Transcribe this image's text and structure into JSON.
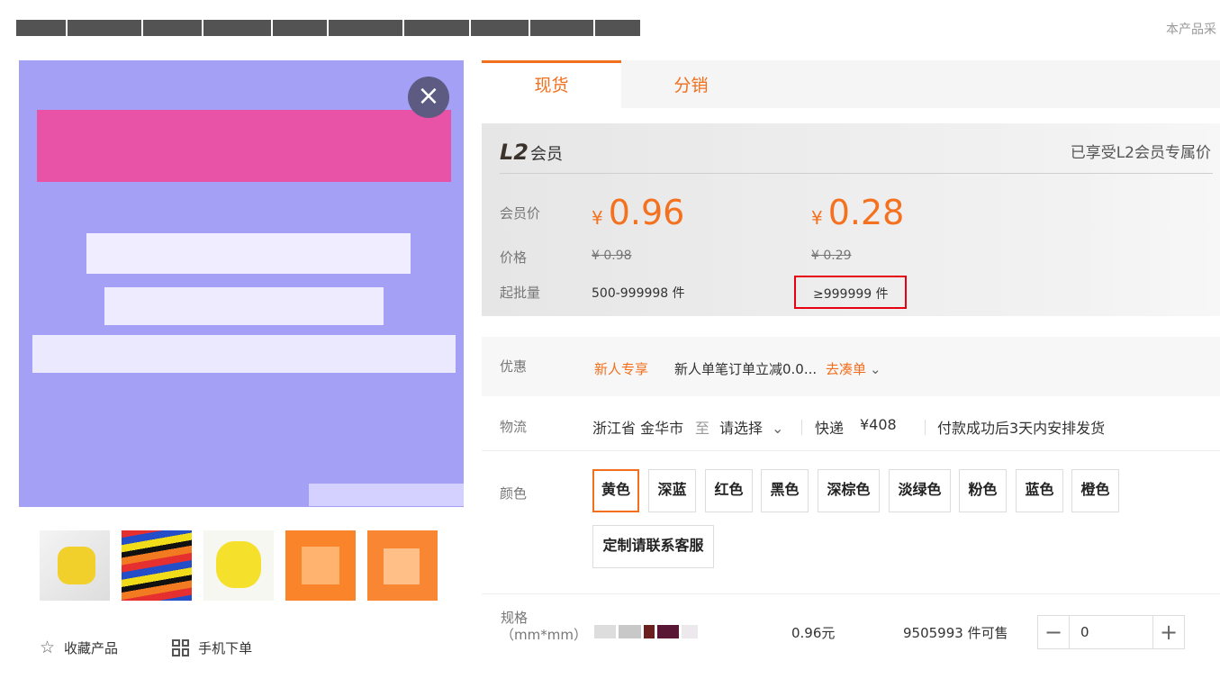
{
  "colors": {
    "accent": "#f16f1d",
    "highlight_border": "#e60012",
    "image_background": "#a4a0f6"
  },
  "product": {
    "note": "本产品采"
  },
  "gallery": {
    "close_icon": "×",
    "actions": [
      {
        "icon": "star-icon",
        "label": "收藏产品"
      },
      {
        "icon": "qr-code-icon",
        "label": "手机下单"
      }
    ]
  },
  "tabs": [
    "现货",
    "分销"
  ],
  "member": {
    "level": "L2",
    "title": "会员",
    "note": "已享受L2会员专属价",
    "labels": {
      "member_price": "会员价",
      "price": "价格",
      "min_batch": "起批量"
    },
    "currency": "¥",
    "tiers": [
      {
        "member_price": "0.96",
        "original_price": "¥ 0.98",
        "batch": "500-999998 件"
      },
      {
        "member_price": "0.28",
        "original_price": "¥ 0.29",
        "batch": "≥999999 件"
      }
    ]
  },
  "promotion": {
    "label": "优惠",
    "tag": "新人专享",
    "text": "新人单笔订单立减0.0...",
    "link": "去凑单"
  },
  "shipping": {
    "label": "物流",
    "origin": "浙江省 金华市",
    "to": "至",
    "destination": "请选择",
    "method": "快递",
    "fee": "¥408",
    "delivery": "付款成功后3天内安排发货"
  },
  "colors_section": {
    "label": "颜色",
    "options": [
      "黄色",
      "深蓝",
      "红色",
      "黑色",
      "深棕色",
      "淡绿色",
      "粉色",
      "蓝色",
      "橙色",
      "定制请联系客服"
    ],
    "selected": "黄色"
  },
  "spec": {
    "label": "规格",
    "unit": "（mm*mm）",
    "price": "0.96元",
    "stock": "9505993 件可售",
    "quantity": "0",
    "minus": "−",
    "plus": "+"
  }
}
